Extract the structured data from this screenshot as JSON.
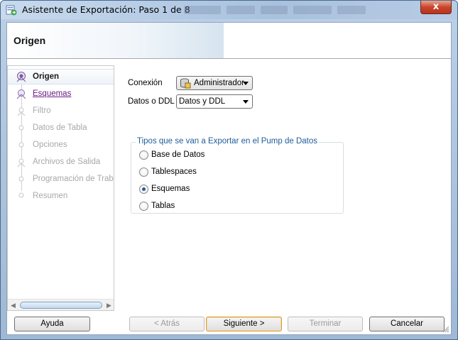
{
  "window": {
    "title": "Asistente de Exportación: Paso 1 de 8",
    "close_label": "x"
  },
  "header": {
    "title": "Origen"
  },
  "nav": {
    "items": [
      {
        "label": "Origen",
        "state": "current"
      },
      {
        "label": "Esquemas",
        "state": "link"
      },
      {
        "label": "Filtro",
        "state": "disabled"
      },
      {
        "label": "Datos de Tabla",
        "state": "disabled"
      },
      {
        "label": "Opciones",
        "state": "disabled"
      },
      {
        "label": "Archivos de Salida",
        "state": "disabled"
      },
      {
        "label": "Programación de Trabajo",
        "state": "disabled"
      },
      {
        "label": "Resumen",
        "state": "disabled"
      }
    ]
  },
  "form": {
    "connection_label": "Conexión",
    "connection_value": "Administrador",
    "data_ddl_label": "Datos o DDL",
    "data_ddl_value": "Datos y DDL",
    "group_legend": "Tipos que se van a Exportar en el Pump de Datos",
    "options": [
      {
        "label": "Base de Datos",
        "checked": false
      },
      {
        "label": "Tablespaces",
        "checked": false
      },
      {
        "label": "Esquemas",
        "checked": true
      },
      {
        "label": "Tablas",
        "checked": false
      }
    ]
  },
  "buttons": {
    "help": "Ayuda",
    "back": "< Atrás",
    "next": "Siguiente >",
    "finish": "Terminar",
    "cancel": "Cancelar"
  },
  "colors": {
    "accent_link": "#6b1c85",
    "legend_blue": "#1e5c99",
    "close_red": "#c9452c"
  }
}
